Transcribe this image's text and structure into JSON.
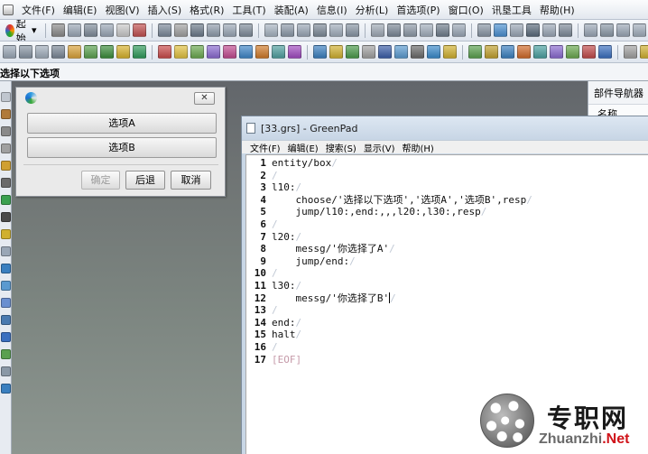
{
  "menubar": {
    "items": [
      "文件(F)",
      "编辑(E)",
      "视图(V)",
      "插入(S)",
      "格式(R)",
      "工具(T)",
      "装配(A)",
      "信息(I)",
      "分析(L)",
      "首选项(P)",
      "窗口(O)",
      "讯垦工具",
      "帮助(H)"
    ]
  },
  "toolbar": {
    "start_label": "起始",
    "icon_colors_row1": [
      "#8a8a8a",
      "#9aa7b6",
      "#7f8c9a",
      "#9aa7b6",
      "#c9c9c9",
      "#c05050",
      "#7a8899",
      "#a0a0a0",
      "#6c7a8a",
      "#8f9cab",
      "#9aa7b6",
      "#7f8c9a",
      "#a6b3c1",
      "#8c99a8",
      "#9aa7b6",
      "#7d8a98",
      "#a0adbb",
      "#8895a4",
      "#9fa9b5",
      "#7a8796",
      "#8d99a7",
      "#a2aebc",
      "#6f7d8c",
      "#9aa7b6",
      "#8895a4",
      "#4a8fd0",
      "#9aa7b6",
      "#5a6b7c",
      "#9aa7b6",
      "#7d8a98",
      "#9aa7b6",
      "#8a98a6",
      "#9aa7b6",
      "#a0adbb",
      "#8895a4",
      "#9fa9b5",
      "#7a8796",
      "#8d99a7",
      "#b0b8c2",
      "#8f9cab"
    ],
    "icon_colors_row2": [
      "#9aa7b6",
      "#8895a4",
      "#a0adbb",
      "#7a8796",
      "#d9a23a",
      "#5aa04f",
      "#3c8d3c",
      "#d7b22c",
      "#2f9a5a",
      "#c94a4a",
      "#e0c040",
      "#6aa84f",
      "#8a6ad0",
      "#c04a8f",
      "#3f86c8",
      "#cf7a2a",
      "#4f9f9f",
      "#a04ac0",
      "#3a7fbf",
      "#d0b030",
      "#4a9a4a",
      "#a0a0a0",
      "#3b5ea8",
      "#5a9ad0",
      "#6a6a6a",
      "#3a8acb",
      "#d0b030",
      "#5aa04f",
      "#c0a030",
      "#3a7fbf",
      "#d06a2a",
      "#4aa0a0",
      "#8a6ad0",
      "#6aa84f",
      "#c04a4a",
      "#3a6fbf",
      "#a0a0a0",
      "#d0b030"
    ]
  },
  "prompt": {
    "text": "选择以下选项"
  },
  "left_strip": {
    "icon_colors": [
      "#c0c6cf",
      "#b07a3a",
      "#8a8a8a",
      "#a0a0a0",
      "#d0a030",
      "#6a6a6a",
      "#3aa050",
      "#4a4a4a",
      "#d0b030",
      "#9aa7b6",
      "#3a7fbf",
      "#5a9ad0",
      "#6a8fd0",
      "#4a7ab0",
      "#3a6fbf",
      "#5aa04f",
      "#8a98a6",
      "#3a7fbf"
    ]
  },
  "navigator": {
    "title": "部件导航器",
    "column": "名称"
  },
  "dialog": {
    "close_symbol": "✕",
    "option_a": "选项A",
    "option_b": "选项B",
    "ok_label": "确定",
    "back_label": "后退",
    "cancel_label": "取消"
  },
  "greenpad": {
    "title": "[33.grs] - GreenPad",
    "menu": [
      "文件(F)",
      "编辑(E)",
      "搜索(S)",
      "显示(V)",
      "帮助(H)"
    ],
    "newline_mark": "/",
    "eof_mark": "[EOF]",
    "lines": [
      {
        "num": "1",
        "text": "entity/box"
      },
      {
        "num": "2",
        "text": ""
      },
      {
        "num": "3",
        "text": "l10:"
      },
      {
        "num": "4",
        "text": "    choose/'选择以下选项','选项A','选项B',resp"
      },
      {
        "num": "5",
        "text": "    jump/l10:,end:,,,l20:,l30:,resp"
      },
      {
        "num": "6",
        "text": ""
      },
      {
        "num": "7",
        "text": "l20:"
      },
      {
        "num": "8",
        "text": "    messg/'你选择了A'"
      },
      {
        "num": "9",
        "text": "    jump/end:"
      },
      {
        "num": "10",
        "text": ""
      },
      {
        "num": "11",
        "text": "l30:"
      },
      {
        "num": "12",
        "text": "    messg/'你选择了B'"
      },
      {
        "num": "13",
        "text": ""
      },
      {
        "num": "14",
        "text": "end:"
      },
      {
        "num": "15",
        "text": "halt"
      },
      {
        "num": "16",
        "text": ""
      },
      {
        "num": "17",
        "text": ""
      }
    ]
  },
  "watermark": {
    "chinese": "专职网",
    "english_prefix": "Zhuanzhi",
    "english_suffix": ".Net"
  }
}
